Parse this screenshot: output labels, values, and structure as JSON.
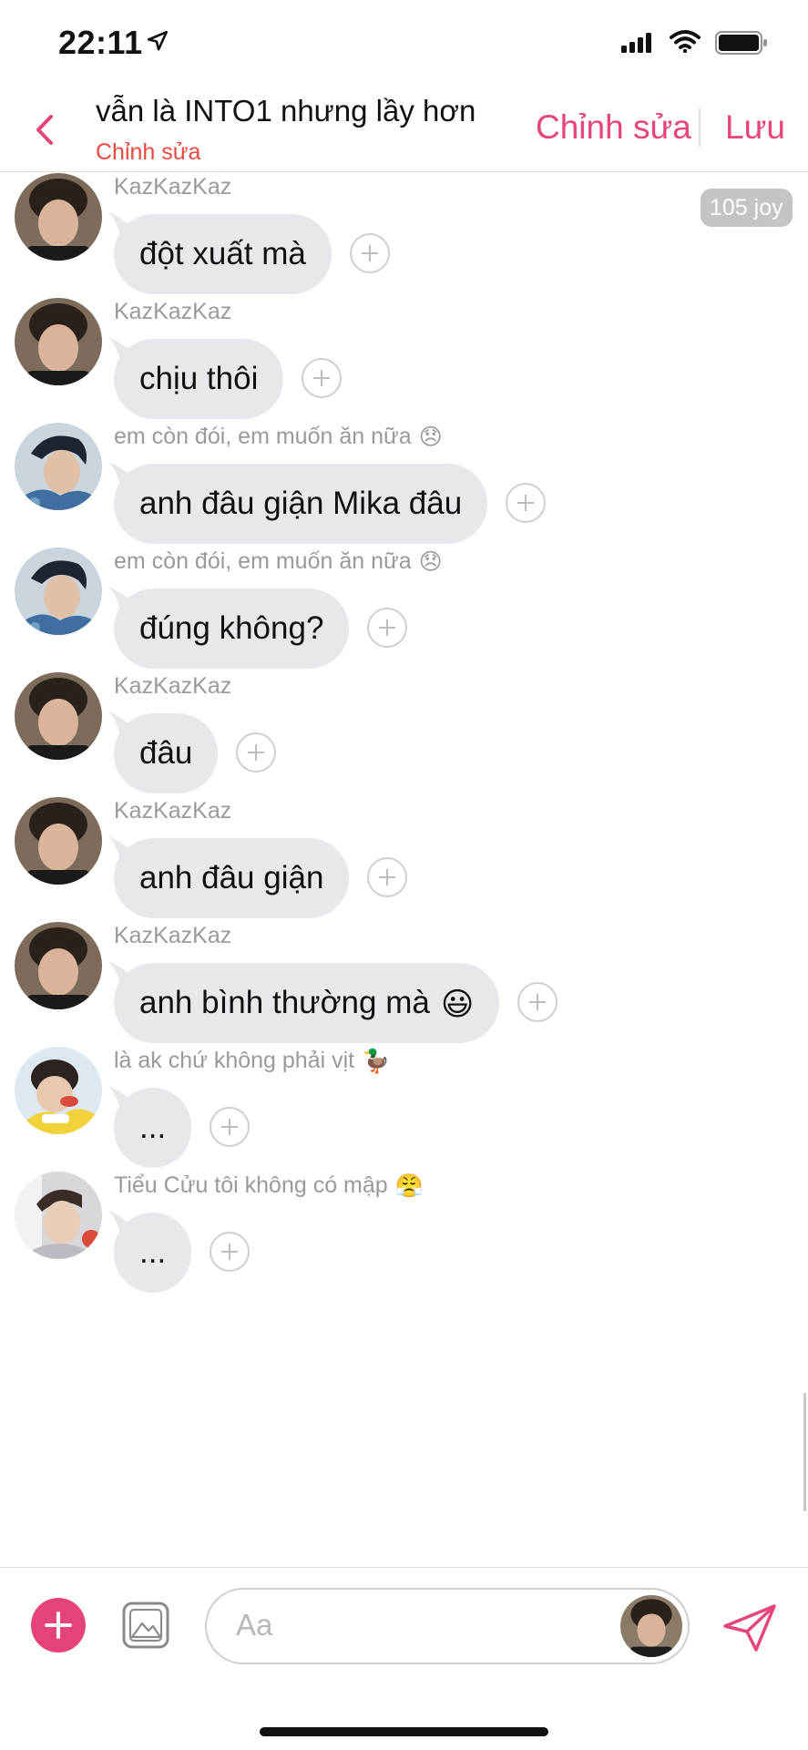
{
  "status_bar": {
    "time": "22:11"
  },
  "header": {
    "title": "vẫn là INTO1 nhưng lầy hơn",
    "subtitle": "Chỉnh sửa",
    "edit_label": "Chỉnh sửa",
    "save_label": "Lưu"
  },
  "messages": [
    {
      "sender": "KazKazKaz",
      "text": "đột xuất mà",
      "avatar": "kaz"
    },
    {
      "sender": "KazKazKaz",
      "text": "chịu thôi",
      "avatar": "kaz"
    },
    {
      "sender": "em còn đói, em muốn ăn nữa",
      "sender_emoji": "😞",
      "text": "anh đâu giận Mika đâu",
      "avatar": "mika"
    },
    {
      "sender": "em còn đói, em muốn ăn nữa",
      "sender_emoji": "😞",
      "text": "đúng không?",
      "avatar": "mika"
    },
    {
      "sender": "KazKazKaz",
      "text": "đâu",
      "avatar": "kaz"
    },
    {
      "sender": "KazKazKaz",
      "text": "anh đâu giận",
      "avatar": "kaz"
    },
    {
      "sender": "KazKazKaz",
      "text": "anh bình thường mà",
      "text_emoji": "😃",
      "avatar": "kaz"
    },
    {
      "sender": "là ak chứ không phải vịt",
      "sender_emoji": "🦆",
      "text": "...",
      "avatar": "duck"
    },
    {
      "sender": "Tiểu Cửu tôi không có mập",
      "sender_emoji": "😤",
      "text": "...",
      "avatar": "cuu"
    }
  ],
  "badge": {
    "label": "105 joy"
  },
  "composer": {
    "placeholder": "Aa"
  },
  "icons": {
    "back": "chevron-left-icon",
    "plus": "plus-icon",
    "image": "image-icon",
    "send": "send-icon",
    "react": "add-reaction-icon",
    "location": "location-arrow-icon"
  },
  "colors": {
    "accent": "#e5457b",
    "subtitle": "#e8493f",
    "bubble": "#e6e8eb",
    "sender_text": "#9a9a9a",
    "badge_bg": "#c4c4c4"
  }
}
